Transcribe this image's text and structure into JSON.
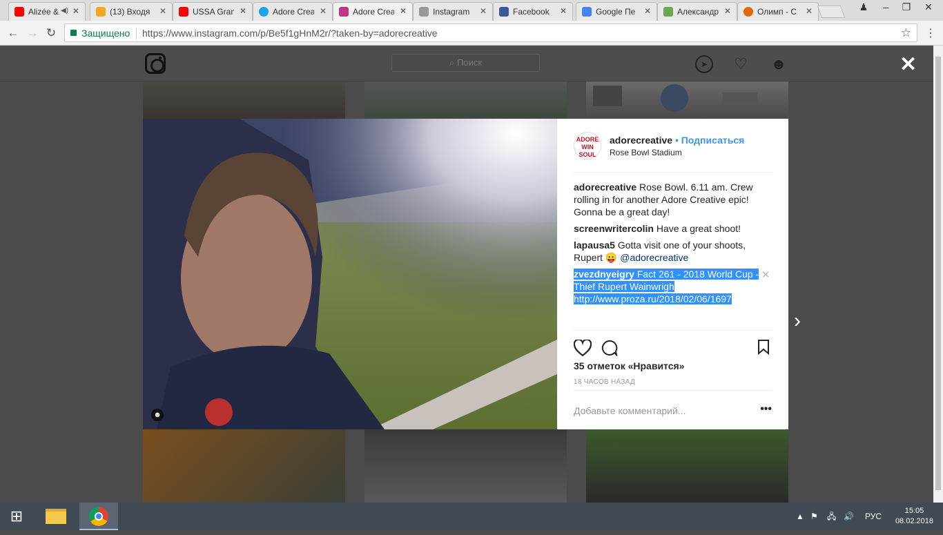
{
  "browser": {
    "tabs": [
      {
        "title": "Alizée &",
        "favicon": "youtube-icon",
        "color": "#ff0000"
      },
      {
        "title": "(13) Входя",
        "favicon": "mail-icon",
        "color": "#f5a623"
      },
      {
        "title": "USSA Gran",
        "favicon": "youtube-icon",
        "color": "#ff0000"
      },
      {
        "title": "Adore Crea",
        "favicon": "twitter-icon",
        "color": "#1da1f2"
      },
      {
        "title": "Adore Crea",
        "favicon": "instagram-icon",
        "color": "#c13584"
      },
      {
        "title": "Instagram",
        "favicon": "instagram-gray-icon",
        "color": "#999999"
      },
      {
        "title": "Facebook",
        "favicon": "facebook-icon",
        "color": "#3b5998"
      },
      {
        "title": "Google Пе",
        "favicon": "google-translate-icon",
        "color": "#4285f4"
      },
      {
        "title": "Александр",
        "favicon": "doc-icon",
        "color": "#6aa84f"
      },
      {
        "title": "Олимп - С",
        "favicon": "olymp-icon",
        "color": "#e06a00"
      }
    ],
    "secure_label": "Защищено",
    "url": "https://www.instagram.com/p/Be5f1gHnM2r/?taken-by=adorecreative"
  },
  "instagram": {
    "search_placeholder": "Поиск",
    "post": {
      "avatar_text": "ADORE WIN SOUL",
      "username": "adorecreative",
      "follow_label": "• Подписаться",
      "location": "Rose Bowl Stadium",
      "comments": [
        {
          "user": "adorecreative",
          "text": " Rose Bowl. 6.11 am. Crew rolling in for another Adore Creative epic! Gonna be a great day!"
        },
        {
          "user": "screenwritercolin",
          "text": " Have a great shoot!"
        },
        {
          "user": "lapausa5",
          "text": " Gotta visit one of your shoots, Rupert 😛 ",
          "mention": "@adorecreative"
        },
        {
          "user": "zvezdnyeigry",
          "text": " Fact 261 - 2018 World Cup - Thief Rupert Wainwrigh http://www.proza.ru/2018/02/06/1697",
          "selected": true
        }
      ],
      "likes": "35 отметок «Нравится»",
      "time_ago": "18 ЧАСОВ НАЗАД",
      "add_comment_placeholder": "Добавьте комментарий..."
    }
  },
  "taskbar": {
    "language": "РУС",
    "time": "15:05",
    "date": "08.02.2018"
  }
}
